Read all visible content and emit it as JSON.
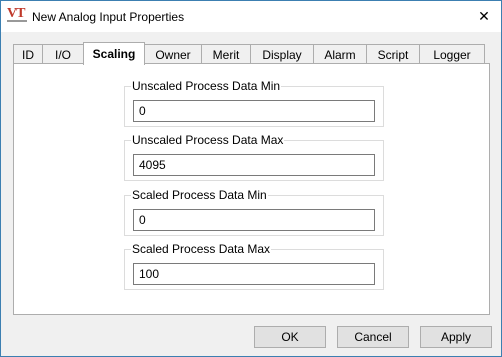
{
  "window": {
    "title": "New Analog Input Properties",
    "app_icon_text": "VT",
    "close_glyph": "✕"
  },
  "tabs": [
    {
      "label": "ID",
      "active": false
    },
    {
      "label": "I/O",
      "active": false
    },
    {
      "label": "Scaling",
      "active": true
    },
    {
      "label": "Owner",
      "active": false
    },
    {
      "label": "Merit",
      "active": false
    },
    {
      "label": "Display",
      "active": false
    },
    {
      "label": "Alarm",
      "active": false
    },
    {
      "label": "Script",
      "active": false
    },
    {
      "label": "Logger",
      "active": false
    }
  ],
  "scaling": {
    "unscaled_min": {
      "label": "Unscaled Process Data Min",
      "value": "0"
    },
    "unscaled_max": {
      "label": "Unscaled Process Data Max",
      "value": "4095"
    },
    "scaled_min": {
      "label": "Scaled Process Data Min",
      "value": "0"
    },
    "scaled_max": {
      "label": "Scaled Process Data Max",
      "value": "100"
    }
  },
  "buttons": {
    "ok": "OK",
    "cancel": "Cancel",
    "apply": "Apply"
  }
}
